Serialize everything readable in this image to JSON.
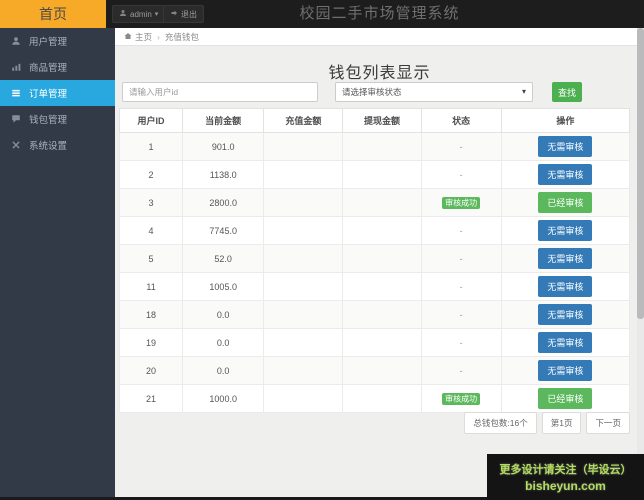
{
  "header": {
    "home": "首页",
    "admin": "admin",
    "logout": "退出",
    "title": "校园二手市场管理系统"
  },
  "sidebar": {
    "items": [
      {
        "label": "用户管理",
        "icon": "user-icon",
        "active": false
      },
      {
        "label": "商品管理",
        "icon": "chart-icon",
        "active": false
      },
      {
        "label": "订单管理",
        "icon": "list-icon",
        "active": true
      },
      {
        "label": "钱包管理",
        "icon": "comment-icon",
        "active": false
      },
      {
        "label": "系统设置",
        "icon": "settings-icon",
        "active": false
      }
    ]
  },
  "breadcrumb": {
    "home": "主页",
    "separator": "›",
    "current": "充值钱包"
  },
  "main": {
    "page_title": "钱包列表显示",
    "search": {
      "placeholder": "请输入用户id",
      "select_value": "请选择审核状态",
      "button": "查找"
    },
    "table": {
      "headers": [
        "用户ID",
        "当前金额",
        "充值金额",
        "提现金额",
        "状态",
        "操作"
      ],
      "rows": [
        {
          "user_id": "1",
          "current": "901.0",
          "recharge": "",
          "withdraw": "",
          "status": "-",
          "action": "无需审核",
          "audited": false
        },
        {
          "user_id": "2",
          "current": "1138.0",
          "recharge": "",
          "withdraw": "",
          "status": "-",
          "action": "无需审核",
          "audited": false
        },
        {
          "user_id": "3",
          "current": "2800.0",
          "recharge": "",
          "withdraw": "",
          "status": "审核成功",
          "action": "已经审核",
          "audited": true
        },
        {
          "user_id": "4",
          "current": "7745.0",
          "recharge": "",
          "withdraw": "",
          "status": "-",
          "action": "无需审核",
          "audited": false
        },
        {
          "user_id": "5",
          "current": "52.0",
          "recharge": "",
          "withdraw": "",
          "status": "-",
          "action": "无需审核",
          "audited": false
        },
        {
          "user_id": "11",
          "current": "1005.0",
          "recharge": "",
          "withdraw": "",
          "status": "-",
          "action": "无需审核",
          "audited": false
        },
        {
          "user_id": "18",
          "current": "0.0",
          "recharge": "",
          "withdraw": "",
          "status": "-",
          "action": "无需审核",
          "audited": false
        },
        {
          "user_id": "19",
          "current": "0.0",
          "recharge": "",
          "withdraw": "",
          "status": "-",
          "action": "无需审核",
          "audited": false
        },
        {
          "user_id": "20",
          "current": "0.0",
          "recharge": "",
          "withdraw": "",
          "status": "-",
          "action": "无需审核",
          "audited": false
        },
        {
          "user_id": "21",
          "current": "1000.0",
          "recharge": "",
          "withdraw": "",
          "status": "审核成功",
          "action": "已经审核",
          "audited": true
        }
      ]
    },
    "pagination": {
      "total": "总钱包数:16个",
      "page": "第1页",
      "next": "下一页"
    }
  },
  "watermark": {
    "line1": "更多设计请关注（毕设云）",
    "line2": "bisheyun.com"
  },
  "colors": {
    "header_dark": "#1d1d1d",
    "sidebar_dark": "#313a46",
    "accent_orange": "#f7a928",
    "active_blue": "#29a8df",
    "primary_blue": "#337ab7",
    "success_green": "#5cb85c",
    "find_green": "#4cb050",
    "watermark_green": "#b2dd5c"
  }
}
